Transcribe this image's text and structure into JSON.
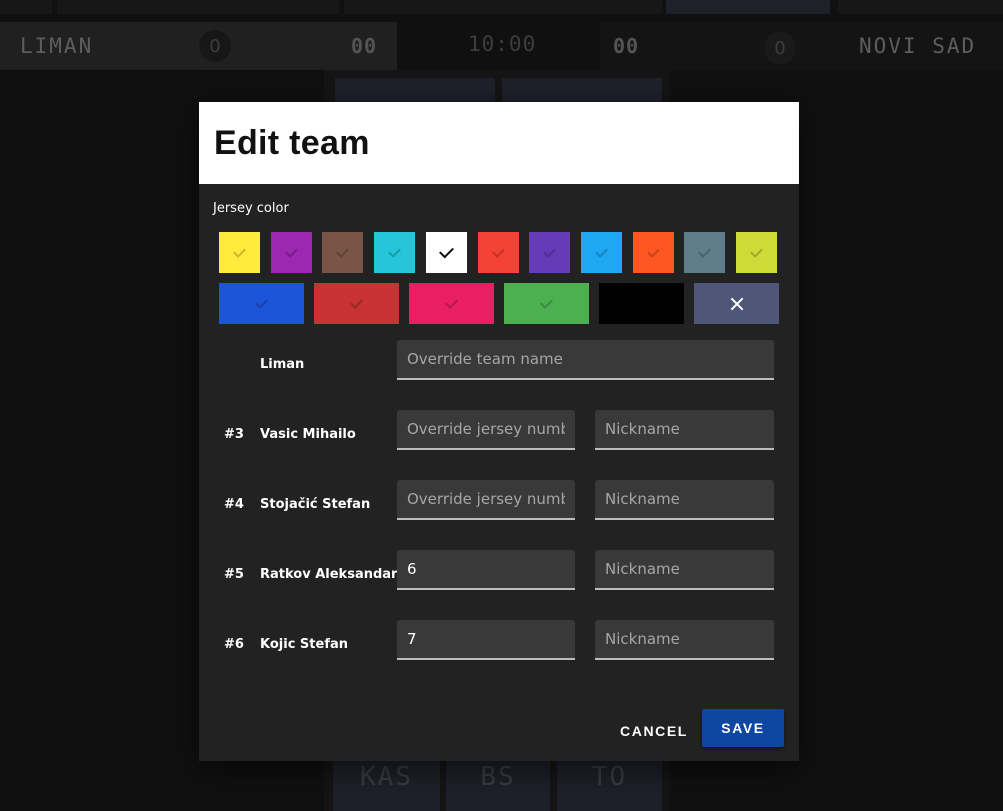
{
  "scoreboard": {
    "home": {
      "name": "LIMAN",
      "fouls": "0",
      "score": "00"
    },
    "away": {
      "name": "NOVI SAD",
      "fouls": "0",
      "score": "00"
    },
    "clock": "10:00",
    "bottom_buttons": [
      "KAS",
      "BS",
      "TO"
    ]
  },
  "dialog": {
    "title": "Edit team",
    "jersey_label": "Jersey color",
    "swatches_row1": [
      {
        "name": "yellow",
        "color": "#ffeb3b",
        "selected": false
      },
      {
        "name": "purple",
        "color": "#9c27b0",
        "selected": false
      },
      {
        "name": "brown",
        "color": "#795548",
        "selected": false
      },
      {
        "name": "cyan",
        "color": "#26c6da",
        "selected": false
      },
      {
        "name": "white",
        "color": "#ffffff",
        "selected": true
      },
      {
        "name": "red",
        "color": "#f44336",
        "selected": false
      },
      {
        "name": "deep-purple",
        "color": "#673ab7",
        "selected": false
      },
      {
        "name": "light-blue",
        "color": "#1fa8f2",
        "selected": false
      },
      {
        "name": "deep-orange",
        "color": "#ff5722",
        "selected": false
      },
      {
        "name": "blue-grey",
        "color": "#607d8b",
        "selected": false
      },
      {
        "name": "lime",
        "color": "#cddc39",
        "selected": false
      }
    ],
    "swatches_row2": [
      {
        "name": "blue",
        "color": "#1d55d9",
        "selected": false
      },
      {
        "name": "dark-red",
        "color": "#c93232",
        "selected": false
      },
      {
        "name": "pink",
        "color": "#e91e63",
        "selected": false
      },
      {
        "name": "green",
        "color": "#4caf50",
        "selected": false
      },
      {
        "name": "black",
        "color": "#000000",
        "selected": false
      }
    ],
    "team": {
      "name": "Liman",
      "override_placeholder": "Override team name",
      "value": ""
    },
    "jersey_placeholder": "Override jersey numbe",
    "nickname_placeholder": "Nickname",
    "players": [
      {
        "number": "#3",
        "name": "Vasic Mihailo",
        "jersey": "",
        "nickname": ""
      },
      {
        "number": "#4",
        "name": "Stojačić Stefan",
        "jersey": "",
        "nickname": ""
      },
      {
        "number": "#5",
        "name": "Ratkov Aleksandar",
        "jersey": "6",
        "nickname": ""
      },
      {
        "number": "#6",
        "name": "Kojic Stefan",
        "jersey": "7",
        "nickname": ""
      }
    ],
    "cancel_label": "CANCEL",
    "save_label": "SAVE"
  }
}
